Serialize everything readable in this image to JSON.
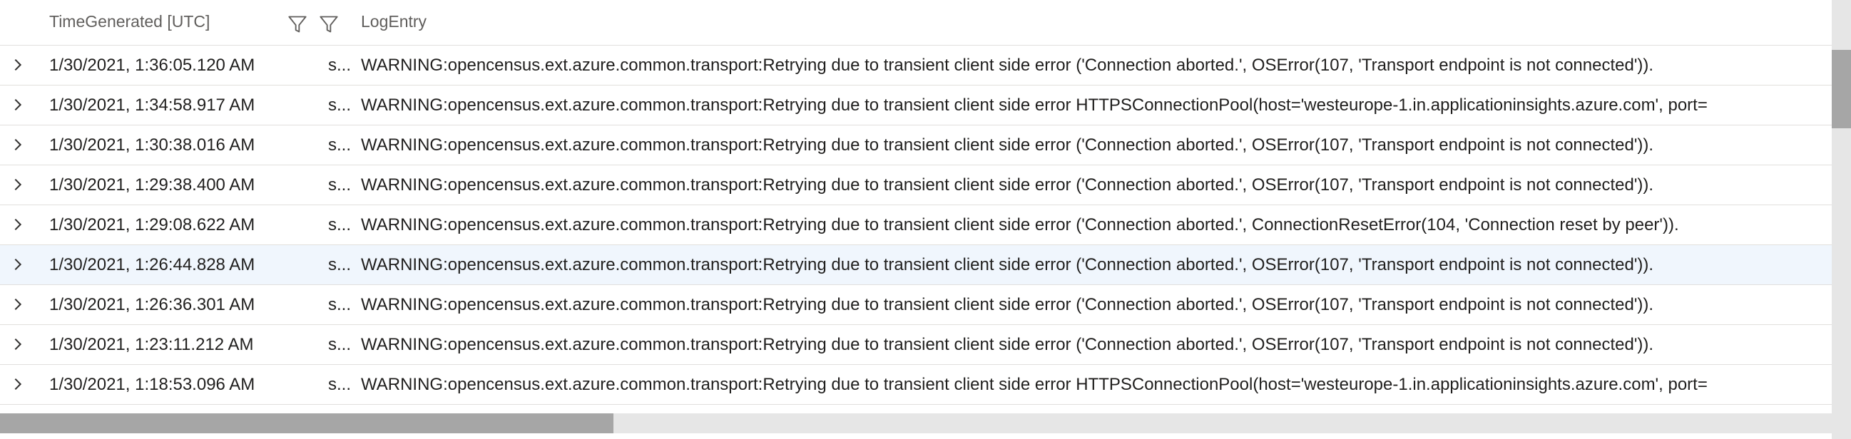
{
  "header": {
    "time_column": "TimeGenerated [UTC]",
    "log_column": "LogEntry",
    "filter_icon_1": "filter-icon",
    "filter_icon_2": "filter-icon"
  },
  "rows": [
    {
      "time": "1/30/2021, 1:36:05.120 AM",
      "trunc": "s...",
      "log": "WARNING:opencensus.ext.azure.common.transport:Retrying due to transient client side error ('Connection aborted.', OSError(107, 'Transport endpoint is not connected'))."
    },
    {
      "time": "1/30/2021, 1:34:58.917 AM",
      "trunc": "s...",
      "log": "WARNING:opencensus.ext.azure.common.transport:Retrying due to transient client side error HTTPSConnectionPool(host='westeurope-1.in.applicationinsights.azure.com', port="
    },
    {
      "time": "1/30/2021, 1:30:38.016 AM",
      "trunc": "s...",
      "log": "WARNING:opencensus.ext.azure.common.transport:Retrying due to transient client side error ('Connection aborted.', OSError(107, 'Transport endpoint is not connected'))."
    },
    {
      "time": "1/30/2021, 1:29:38.400 AM",
      "trunc": "s...",
      "log": "WARNING:opencensus.ext.azure.common.transport:Retrying due to transient client side error ('Connection aborted.', OSError(107, 'Transport endpoint is not connected'))."
    },
    {
      "time": "1/30/2021, 1:29:08.622 AM",
      "trunc": "s...",
      "log": "WARNING:opencensus.ext.azure.common.transport:Retrying due to transient client side error ('Connection aborted.', ConnectionResetError(104, 'Connection reset by peer'))."
    },
    {
      "time": "1/30/2021, 1:26:44.828 AM",
      "trunc": "s...",
      "log": "WARNING:opencensus.ext.azure.common.transport:Retrying due to transient client side error ('Connection aborted.', OSError(107, 'Transport endpoint is not connected'))."
    },
    {
      "time": "1/30/2021, 1:26:36.301 AM",
      "trunc": "s...",
      "log": "WARNING:opencensus.ext.azure.common.transport:Retrying due to transient client side error ('Connection aborted.', OSError(107, 'Transport endpoint is not connected'))."
    },
    {
      "time": "1/30/2021, 1:23:11.212 AM",
      "trunc": "s...",
      "log": "WARNING:opencensus.ext.azure.common.transport:Retrying due to transient client side error ('Connection aborted.', OSError(107, 'Transport endpoint is not connected'))."
    },
    {
      "time": "1/30/2021, 1:18:53.096 AM",
      "trunc": "s...",
      "log": "WARNING:opencensus.ext.azure.common.transport:Retrying due to transient client side error HTTPSConnectionPool(host='westeurope-1.in.applicationinsights.azure.com', port="
    }
  ],
  "colors": {
    "selected_row": "#f0f6fd",
    "border": "#e1dfdd",
    "scroll_track": "#e6e6e6",
    "scroll_thumb": "#a6a6a6"
  },
  "icons": {
    "expand": "chevron-right-icon",
    "filter": "filter-icon"
  }
}
